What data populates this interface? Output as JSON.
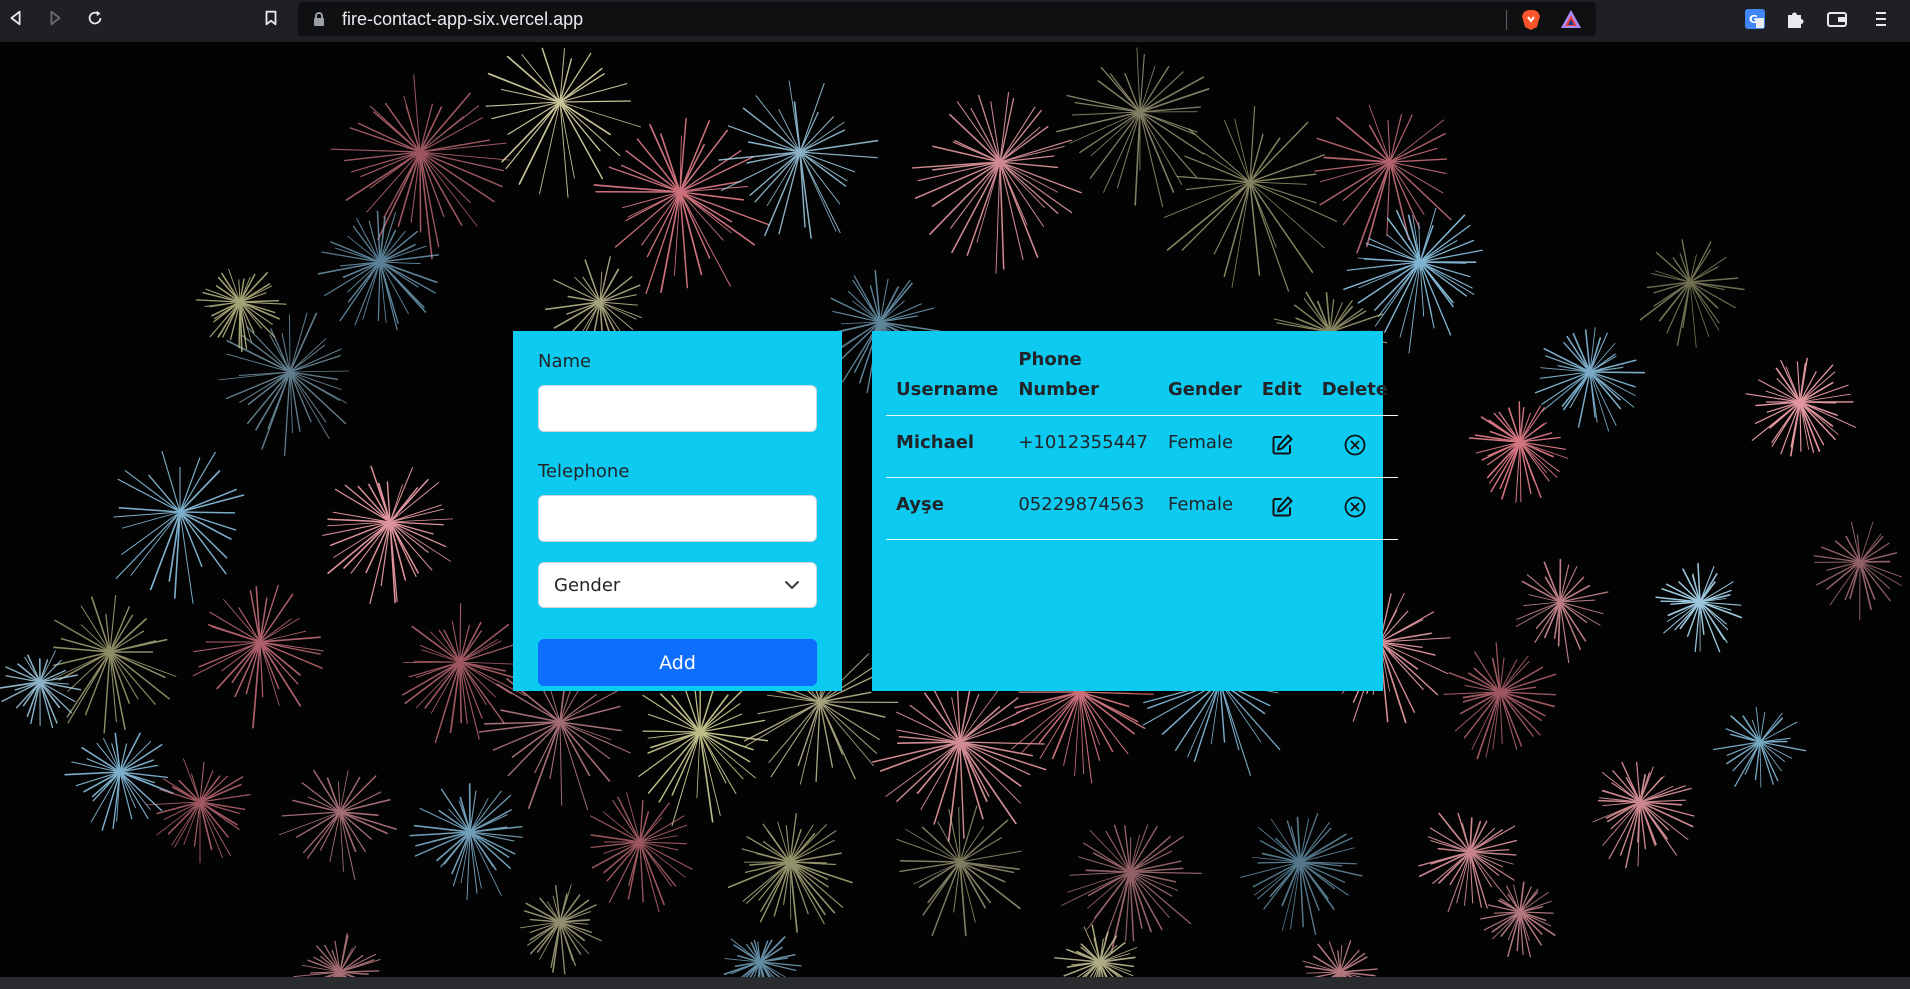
{
  "browser": {
    "url": "fire-contact-app-six.vercel.app"
  },
  "form": {
    "name_label": "Name",
    "name_value": "",
    "telephone_label": "Telephone",
    "telephone_value": "",
    "gender_select": {
      "selected": "Gender"
    },
    "add_label": "Add"
  },
  "table": {
    "headers": {
      "username": "Username",
      "phone_line1": "Phone",
      "phone_line2": "Number",
      "gender": "Gender",
      "edit": "Edit",
      "delete": "Delete"
    },
    "rows": [
      {
        "username": "Michael",
        "phone": "+1012355447",
        "gender": "Female"
      },
      {
        "username": "Ayşe",
        "phone": "05229874563",
        "gender": "Female"
      }
    ]
  },
  "icons": {
    "edit": "edit-icon",
    "delete": "circle-x-icon"
  },
  "colors": {
    "panel": "#0dcaf0",
    "button": "#0d6efd",
    "chrome": "#1f2023",
    "omnibox": "#0f1012"
  }
}
